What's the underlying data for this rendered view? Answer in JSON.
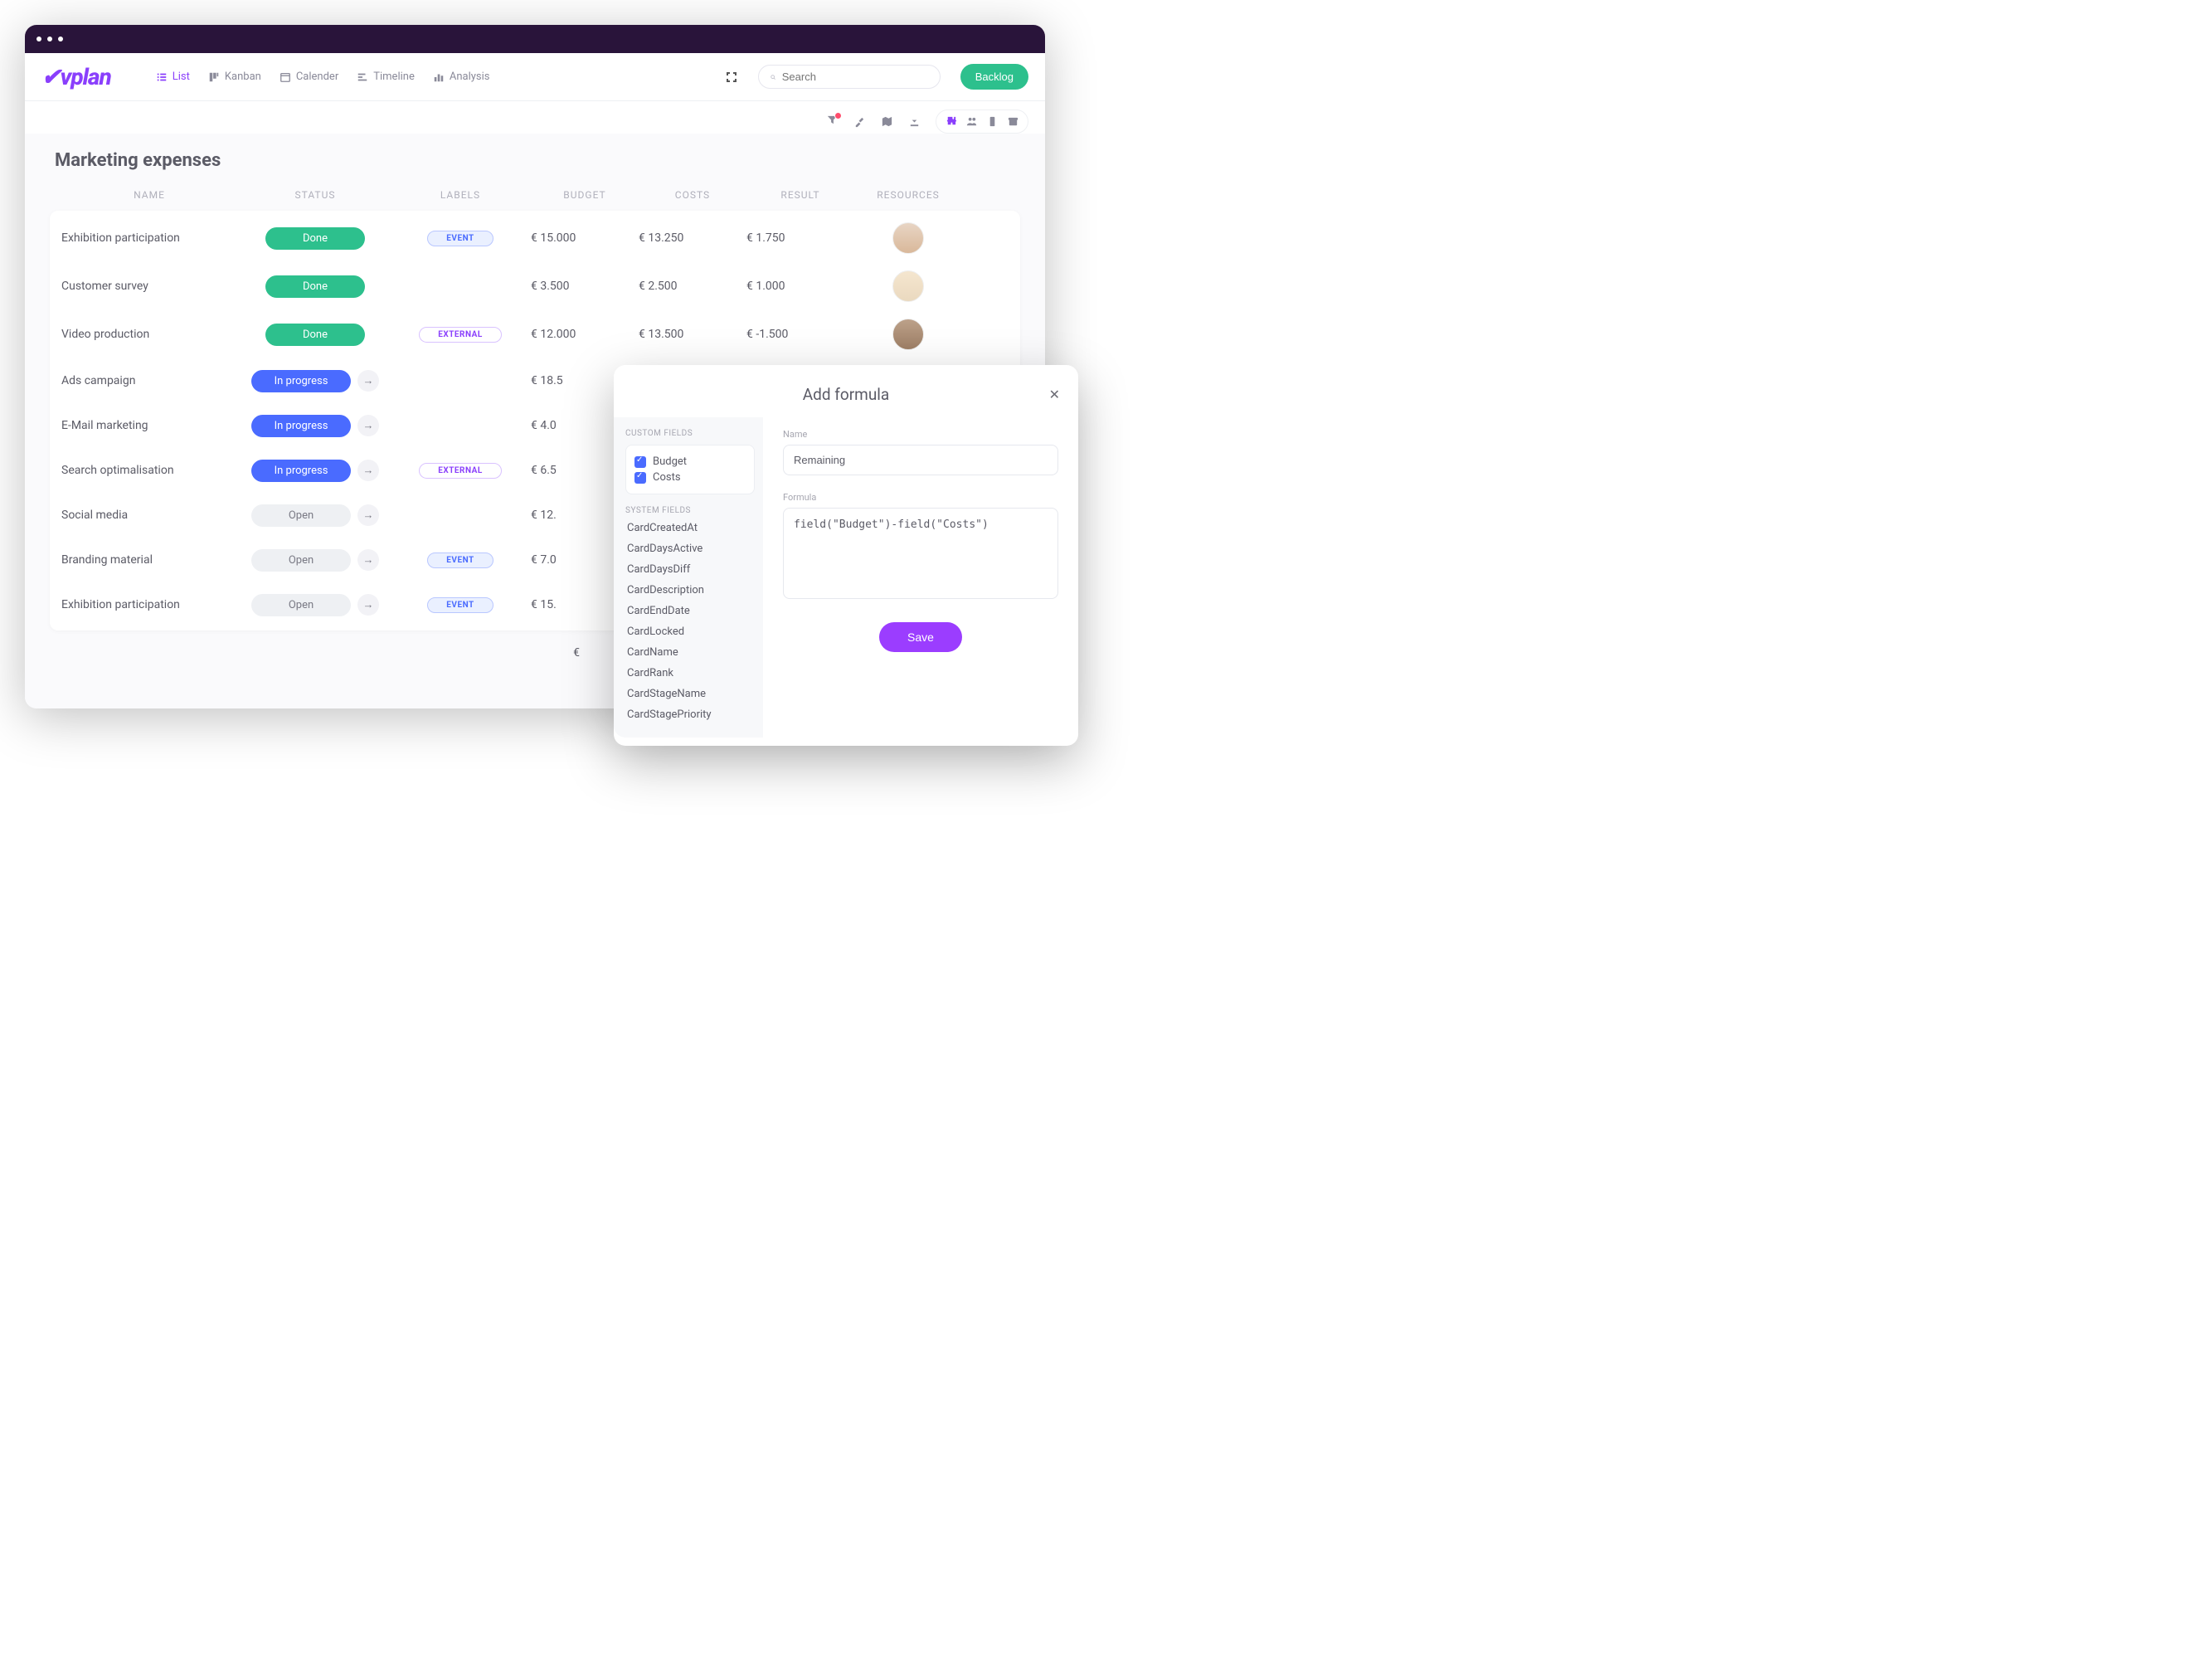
{
  "header": {
    "logo": "vplan",
    "tabs": {
      "list": "List",
      "kanban": "Kanban",
      "calendar": "Calender",
      "timeline": "Timeline",
      "analysis": "Analysis"
    },
    "search_placeholder": "Search",
    "backlog": "Backlog"
  },
  "board": {
    "title": "Marketing expenses"
  },
  "columns": {
    "name": "NAME",
    "status": "STATUS",
    "labels": "LABELS",
    "budget": "BUDGET",
    "costs": "COSTS",
    "result": "RESULT",
    "resources": "RESOURCES"
  },
  "status_labels": {
    "done": "Done",
    "inprogress": "In progress",
    "open": "Open"
  },
  "label_values": {
    "event": "EVENT",
    "external": "EXTERNAL"
  },
  "rows": [
    {
      "name": "Exhibition participation",
      "status": "done",
      "label": "event",
      "budget": "€ 15.000",
      "costs": "€ 13.250",
      "result": "€ 1.750",
      "avatar": "a1"
    },
    {
      "name": "Customer survey",
      "status": "done",
      "label": "",
      "budget": "€ 3.500",
      "costs": "€ 2.500",
      "result": "€ 1.000",
      "avatar": "a2"
    },
    {
      "name": "Video production",
      "status": "done",
      "label": "external",
      "budget": "€ 12.000",
      "costs": "€ 13.500",
      "result": "€ -1.500",
      "avatar": "a3"
    },
    {
      "name": "Ads campaign",
      "status": "inprogress",
      "label": "",
      "budget": "€ 18.5",
      "costs": "",
      "result": "",
      "avatar": ""
    },
    {
      "name": "E-Mail marketing",
      "status": "inprogress",
      "label": "",
      "budget": "€ 4.0",
      "costs": "",
      "result": "",
      "avatar": ""
    },
    {
      "name": "Search optimalisation",
      "status": "inprogress",
      "label": "external",
      "budget": "€ 6.5",
      "costs": "",
      "result": "",
      "avatar": ""
    },
    {
      "name": "Social media",
      "status": "open",
      "label": "",
      "budget": "€ 12.",
      "costs": "",
      "result": "",
      "avatar": ""
    },
    {
      "name": "Branding material",
      "status": "open",
      "label": "event",
      "budget": "€ 7.0",
      "costs": "",
      "result": "",
      "avatar": ""
    },
    {
      "name": "Exhibition participation",
      "status": "open",
      "label": "event",
      "budget": "€ 15.",
      "costs": "",
      "result": "",
      "avatar": ""
    }
  ],
  "totals_budget": "€",
  "modal": {
    "title": "Add formula",
    "custom_fields_label": "CUSTOM FIELDS",
    "custom_fields": [
      "Budget",
      "Costs"
    ],
    "system_fields_label": "SYSTEM FIELDS",
    "system_fields": [
      "CardCreatedAt",
      "CardDaysActive",
      "CardDaysDiff",
      "CardDescription",
      "CardEndDate",
      "CardLocked",
      "CardName",
      "CardRank",
      "CardStageName",
      "CardStagePriority"
    ],
    "name_label": "Name",
    "name_value": "Remaining",
    "formula_label": "Formula",
    "formula_value": "field(\"Budget\")-field(\"Costs\")",
    "save": "Save"
  }
}
